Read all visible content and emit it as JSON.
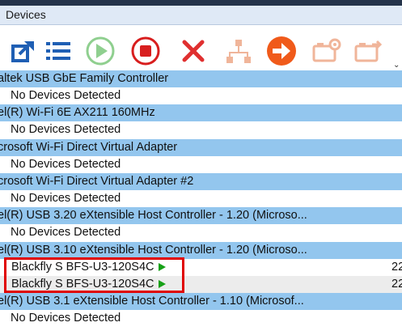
{
  "window": {
    "title": "Devices"
  },
  "toolbar": {
    "buttons": [
      {
        "name": "connect-icon",
        "color": "#1f5fb4"
      },
      {
        "name": "list-icon",
        "color": "#1f5fb4"
      },
      {
        "name": "play-icon",
        "color": "#8fcf8f"
      },
      {
        "name": "stop-icon",
        "color": "#d81e1e"
      },
      {
        "name": "remove-icon",
        "color": "#e03030"
      },
      {
        "name": "network-icon",
        "color": "#f0b59a"
      },
      {
        "name": "arrow-right-icon",
        "color": "#f05a1a"
      },
      {
        "name": "camera-settings-icon",
        "color": "#f0b59a"
      },
      {
        "name": "camera-export-icon",
        "color": "#f0b59a"
      }
    ],
    "overflow": "⌄"
  },
  "devices": {
    "rows": [
      {
        "type": "hdr",
        "text": "altek USB GbE Family Controller"
      },
      {
        "type": "nodev",
        "text": "No Devices Detected"
      },
      {
        "type": "hdr",
        "text": "el(R) Wi-Fi 6E AX211 160MHz"
      },
      {
        "type": "nodev",
        "text": "No Devices Detected"
      },
      {
        "type": "hdr",
        "text": "crosoft Wi-Fi Direct Virtual Adapter"
      },
      {
        "type": "nodev",
        "text": "No Devices Detected"
      },
      {
        "type": "hdr",
        "text": "crosoft Wi-Fi Direct Virtual Adapter #2"
      },
      {
        "type": "nodev",
        "text": "No Devices Detected"
      },
      {
        "type": "hdr",
        "text": "el(R) USB 3.20 eXtensible Host Controller - 1.20 (Microso..."
      },
      {
        "type": "nodev",
        "text": "No Devices Detected"
      },
      {
        "type": "hdr",
        "text": "el(R) USB 3.10 eXtensible Host Controller - 1.20 (Microso..."
      },
      {
        "type": "cam",
        "text": "Blackfly S BFS-U3-120S4C",
        "extra": "22"
      },
      {
        "type": "cam",
        "text": "Blackfly S BFS-U3-120S4C",
        "extra": "22"
      },
      {
        "type": "hdr",
        "text": "el(R) USB 3.1 eXtensible Host Controller - 1.10 (Microsof..."
      },
      {
        "type": "nodev",
        "text": "No Devices Detected"
      }
    ]
  }
}
